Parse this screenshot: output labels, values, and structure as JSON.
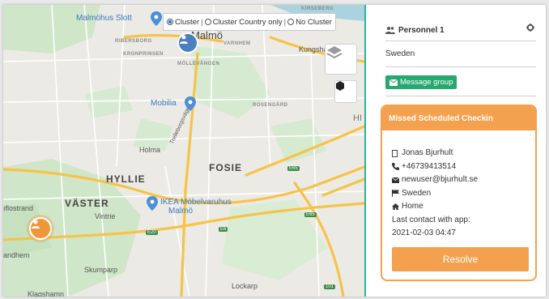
{
  "map": {
    "cluster_options": [
      "Cluster",
      "Cluster Country only",
      "No Cluster"
    ],
    "cluster_selected": "Cluster",
    "labels": {
      "malmohus": "Malmöhus Slott",
      "malmo": "Malmö",
      "kirseberg": "KIRSEBERG",
      "ribersborg": "RIBERSBORG",
      "kronprinsen": "KRONPRINSEN",
      "mollevangen": "MÖLLEVÅNGEN",
      "varnhem": "VARNHEM",
      "kungshal": "Kungshal",
      "mobilia": "Mobilia",
      "rosengard": "ROSENGÅRD",
      "holma": "Holma",
      "hyllie": "HYLLIE",
      "fosie": "FOSIE",
      "trelleborgsvagen": "Trelleborgsvägen",
      "vaster": "VÄSTER",
      "ikea": "IKEA Möbelvaruhus",
      "ikea2": "Malmö",
      "vintrie": "Vintrie",
      "flostrand": "ıflostrand",
      "andhem": "andhem",
      "skumparp": "Skumparp",
      "lockarp": "Lockarp",
      "klagshamn": "Klagshamn",
      "e65a": "E65",
      "e65b": "E65",
      "e20": "E20",
      "e6": "E6",
      "r101": "101",
      "hi": "HI"
    }
  },
  "panel": {
    "title": "Personnel 1",
    "country": "Sweden",
    "message_button": "Message group",
    "alert": {
      "title": "Missed Scheduled Checkin",
      "name": "Jonas Bjurhult",
      "phone": "+46739413514",
      "email": "newuser@bjurhult.se",
      "country": "Sweden",
      "location": "Home",
      "last_contact_label": "Last contact with app:",
      "last_contact_value": "2021-02-03 04:47",
      "resolve_button": "Resolve"
    }
  },
  "colors": {
    "accent_orange": "#f4a14f",
    "message_green": "#26a96e",
    "divider_teal": "#27b39a",
    "road_yellow": "#f6c34a",
    "park_green": "#c8e3c2"
  },
  "icons": [
    "users-icon",
    "gear-icon",
    "layers-icon",
    "hexagon-icon",
    "envelope-icon",
    "user-icon",
    "phone-icon",
    "flag-icon",
    "home-icon",
    "map-pin-icon"
  ]
}
